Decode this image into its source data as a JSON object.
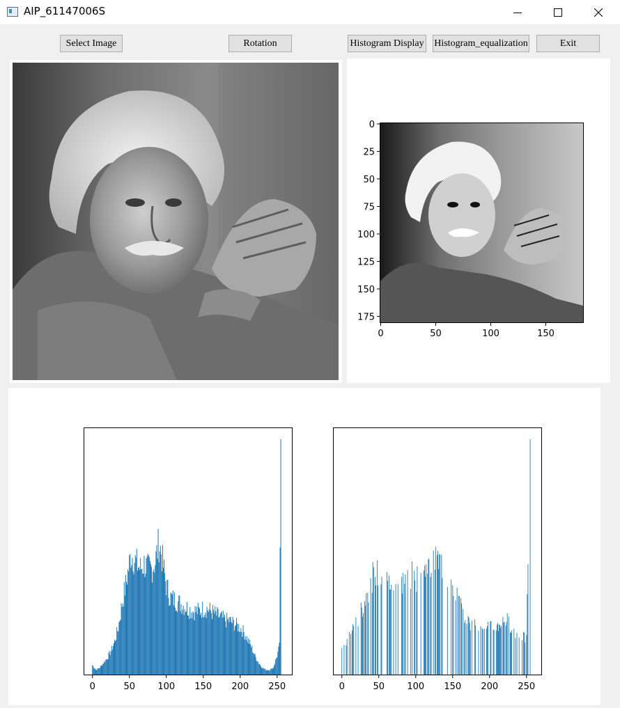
{
  "window": {
    "title": "AIP_61147006S",
    "controls": [
      "minimize",
      "maximize",
      "close"
    ]
  },
  "toolbar": {
    "select_image": "Select Image",
    "rotation": "Rotation",
    "histogram_display": "Histogram Display",
    "histogram_equalization": "Histogram_equalization",
    "exit": "Exit"
  },
  "colors": {
    "bar": "#1f77b4",
    "window_bg": "#f0f0f0"
  },
  "images": {
    "original": "grayscale portrait photo",
    "plot_yticks": [
      "0",
      "25",
      "50",
      "75",
      "100",
      "125",
      "150",
      "175"
    ],
    "plot_xticks": [
      "0",
      "50",
      "100",
      "150"
    ]
  },
  "chart_data": [
    {
      "type": "bar",
      "xlim": [
        -12,
        270
      ],
      "xticks": [
        "0",
        "50",
        "100",
        "150",
        "200",
        "250"
      ],
      "peaks": [
        [
          0,
          0.04
        ],
        [
          5,
          0.02
        ],
        [
          10,
          0.03
        ],
        [
          15,
          0.05
        ],
        [
          20,
          0.07
        ],
        [
          25,
          0.1
        ],
        [
          30,
          0.14
        ],
        [
          35,
          0.2
        ],
        [
          40,
          0.3
        ],
        [
          45,
          0.38
        ],
        [
          50,
          0.47
        ],
        [
          52,
          0.51
        ],
        [
          55,
          0.5
        ],
        [
          60,
          0.47
        ],
        [
          65,
          0.45
        ],
        [
          70,
          0.47
        ],
        [
          75,
          0.45
        ],
        [
          80,
          0.45
        ],
        [
          85,
          0.48
        ],
        [
          88,
          0.53
        ],
        [
          90,
          0.56
        ],
        [
          93,
          0.52
        ],
        [
          95,
          0.48
        ],
        [
          100,
          0.38
        ],
        [
          105,
          0.33
        ],
        [
          110,
          0.32
        ],
        [
          115,
          0.31
        ],
        [
          120,
          0.3
        ],
        [
          125,
          0.29
        ],
        [
          130,
          0.28
        ],
        [
          135,
          0.27
        ],
        [
          140,
          0.27
        ],
        [
          145,
          0.27
        ],
        [
          150,
          0.28
        ],
        [
          155,
          0.28
        ],
        [
          160,
          0.27
        ],
        [
          165,
          0.26
        ],
        [
          170,
          0.25
        ],
        [
          175,
          0.24
        ],
        [
          180,
          0.23
        ],
        [
          185,
          0.23
        ],
        [
          190,
          0.22
        ],
        [
          195,
          0.21
        ],
        [
          200,
          0.2
        ],
        [
          205,
          0.18
        ],
        [
          210,
          0.15
        ],
        [
          215,
          0.12
        ],
        [
          220,
          0.08
        ],
        [
          225,
          0.05
        ],
        [
          230,
          0.03
        ],
        [
          235,
          0.02
        ],
        [
          240,
          0.02
        ],
        [
          245,
          0.03
        ],
        [
          250,
          0.08
        ],
        [
          253,
          0.12
        ],
        [
          255,
          1.0
        ]
      ]
    },
    {
      "type": "bar",
      "xlim": [
        -12,
        270
      ],
      "xticks": [
        "0",
        "50",
        "100",
        "150",
        "200",
        "250"
      ],
      "peaks": [
        [
          0,
          0.1
        ],
        [
          5,
          0.13
        ],
        [
          10,
          0.17
        ],
        [
          15,
          0.2
        ],
        [
          20,
          0.22
        ],
        [
          25,
          0.26
        ],
        [
          30,
          0.3
        ],
        [
          35,
          0.35
        ],
        [
          40,
          0.4
        ],
        [
          45,
          0.44
        ],
        [
          50,
          0.42
        ],
        [
          55,
          0.41
        ],
        [
          60,
          0.4
        ],
        [
          65,
          0.39
        ],
        [
          70,
          0.39
        ],
        [
          75,
          0.39
        ],
        [
          80,
          0.39
        ],
        [
          85,
          0.4
        ],
        [
          90,
          0.41
        ],
        [
          95,
          0.42
        ],
        [
          100,
          0.41
        ],
        [
          105,
          0.42
        ],
        [
          110,
          0.43
        ],
        [
          115,
          0.45
        ],
        [
          120,
          0.46
        ],
        [
          125,
          0.47
        ],
        [
          130,
          0.48
        ],
        [
          135,
          0.47
        ],
        [
          140,
          0.44
        ],
        [
          145,
          0.41
        ],
        [
          150,
          0.38
        ],
        [
          155,
          0.35
        ],
        [
          160,
          0.3
        ],
        [
          165,
          0.26
        ],
        [
          170,
          0.23
        ],
        [
          175,
          0.21
        ],
        [
          180,
          0.21
        ],
        [
          185,
          0.2
        ],
        [
          190,
          0.22
        ],
        [
          195,
          0.22
        ],
        [
          200,
          0.2
        ],
        [
          205,
          0.2
        ],
        [
          210,
          0.2
        ],
        [
          215,
          0.22
        ],
        [
          220,
          0.23
        ],
        [
          225,
          0.23
        ],
        [
          230,
          0.2
        ],
        [
          235,
          0.18
        ],
        [
          240,
          0.17
        ],
        [
          245,
          0.16
        ],
        [
          250,
          0.15
        ],
        [
          255,
          1.0
        ]
      ]
    }
  ]
}
